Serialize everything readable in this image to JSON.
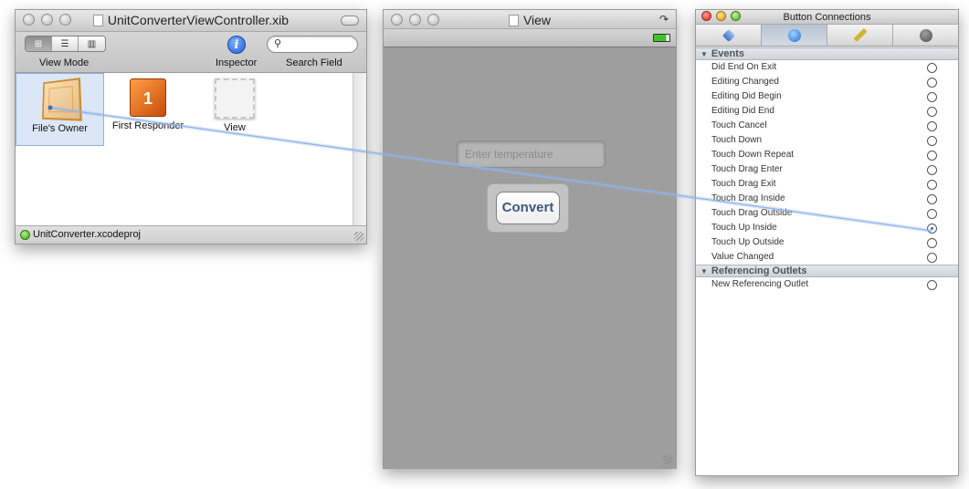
{
  "document_window": {
    "title": "UnitConverterViewController.xib",
    "toolbar": {
      "view_mode_label": "View Mode",
      "inspector_label": "Inspector",
      "search_label": "Search Field",
      "search_value": "",
      "view_modes": [
        "icon",
        "list",
        "column"
      ],
      "selected_view_mode": "icon"
    },
    "objects": [
      {
        "label": "File's Owner",
        "icon": "cube-icon",
        "selected": true
      },
      {
        "label": "First Responder",
        "icon": "first-responder-icon",
        "selected": false
      },
      {
        "label": "View",
        "icon": "view-icon",
        "selected": false
      }
    ],
    "status": "UnitConverter.xcodeproj"
  },
  "view_window": {
    "title": "View",
    "text_field_placeholder": "Enter temperature",
    "button_label": "Convert"
  },
  "inspector": {
    "title": "Button Connections",
    "tabs": [
      "attributes-icon",
      "connections-icon",
      "size-icon",
      "identity-icon"
    ],
    "selected_tab": 1,
    "events_header": "Events",
    "events": [
      {
        "label": "Did End On Exit",
        "connected": false
      },
      {
        "label": "Editing Changed",
        "connected": false
      },
      {
        "label": "Editing Did Begin",
        "connected": false
      },
      {
        "label": "Editing Did End",
        "connected": false
      },
      {
        "label": "Touch Cancel",
        "connected": false
      },
      {
        "label": "Touch Down",
        "connected": false
      },
      {
        "label": "Touch Down Repeat",
        "connected": false
      },
      {
        "label": "Touch Drag Enter",
        "connected": false
      },
      {
        "label": "Touch Drag Exit",
        "connected": false
      },
      {
        "label": "Touch Drag Inside",
        "connected": false
      },
      {
        "label": "Touch Drag Outside",
        "connected": false
      },
      {
        "label": "Touch Up Inside",
        "connected": true
      },
      {
        "label": "Touch Up Outside",
        "connected": false
      },
      {
        "label": "Value Changed",
        "connected": false
      }
    ],
    "outlets_header": "Referencing Outlets",
    "outlets": [
      {
        "label": "New Referencing Outlet",
        "connected": false
      }
    ]
  },
  "colors": {
    "connection_line": "#8fb4e8",
    "selection": "#dbe6f6"
  }
}
